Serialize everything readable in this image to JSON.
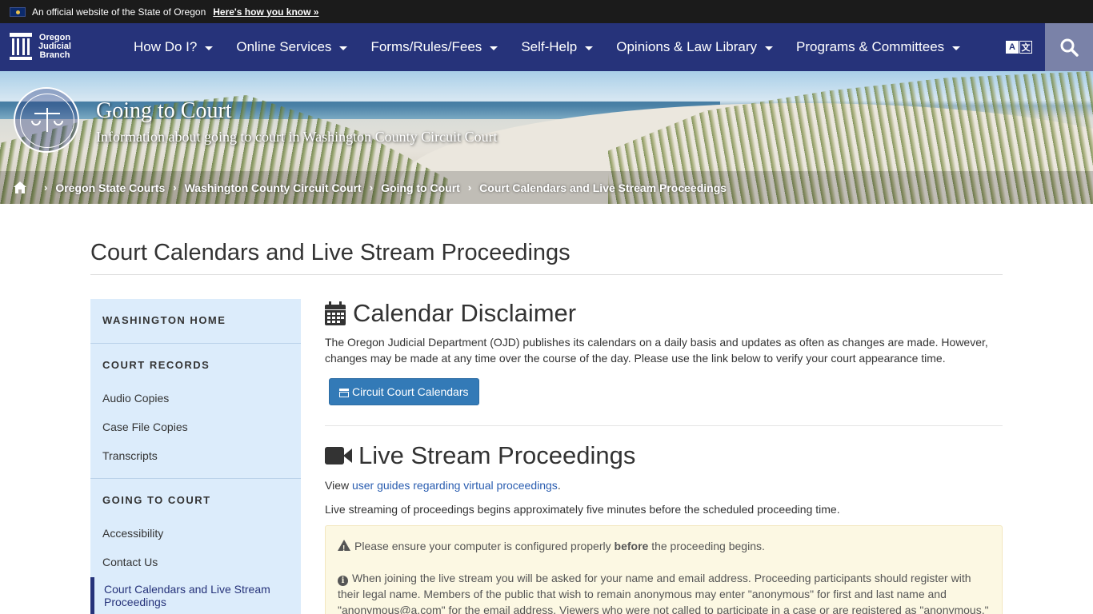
{
  "official_banner": {
    "text": "An official website of the State of Oregon",
    "link": "Here's how you know »"
  },
  "logo": {
    "line1": "Oregon",
    "line2": "Judicial",
    "line3": "Branch"
  },
  "nav": {
    "items": [
      {
        "label": "How Do I?"
      },
      {
        "label": "Online Services"
      },
      {
        "label": "Forms/Rules/Fees"
      },
      {
        "label": "Self-Help"
      },
      {
        "label": "Opinions & Law Library"
      },
      {
        "label": "Programs & Committees"
      }
    ],
    "translate_a": "A",
    "translate_b": "文"
  },
  "hero": {
    "title": "Going to Court",
    "subtitle": "Information about going to court in Washington County Circuit Court"
  },
  "breadcrumb": {
    "items": [
      "Oregon State Courts",
      "Washington County Circuit Court",
      "Going to Court",
      "Court Calendars and Live Stream Proceedings"
    ]
  },
  "page": {
    "title": "Court Calendars and Live Stream Proceedings"
  },
  "sidebar": {
    "home": "WASHINGTON HOME",
    "court_records": "COURT RECORDS",
    "records_links": [
      "Audio Copies",
      "Case File Copies",
      "Transcripts"
    ],
    "going_to_court": "GOING TO COURT",
    "gtc_links": [
      "Accessibility",
      "Contact Us"
    ],
    "active": "Court Calendars and Live Stream Proceedings"
  },
  "calendar": {
    "heading": "Calendar Disclaimer",
    "body": "The Oregon Judicial Department (OJD) publishes its calendars on a daily basis and updates as often as changes are made. However, changes may be made at any time over the course of the day. Please use the link below to verify your court appearance time.",
    "button": "Circuit Court Calendars"
  },
  "livestream": {
    "heading": "Live Stream Proceedings",
    "view_prefix": "View ",
    "view_link": "user guides regarding virtual proceedings",
    "view_suffix": ".",
    "begins": "Live streaming of proceedings begins approximately five minutes before the scheduled proceeding time.",
    "alert_warn_pre": "Please ensure your computer is configured properly ",
    "alert_warn_bold": "before",
    "alert_warn_post": " the proceeding begins.",
    "alert_info": "When joining the live stream you will be asked for your name and email address. Proceeding participants should register with their legal name. Members of the public that wish to remain anonymous may enter \"anonymous\" for first and last name and \"anonymous@a.com\" for the email address. Viewers who were not called to participate in a case or are registered as \"anonymous,\""
  },
  "colors": {
    "nav_bg": "#26337a",
    "sidebar_bg": "#dcecfb",
    "button_bg": "#337ab7",
    "alert_bg": "#fcf8e3",
    "link": "#2a5db0"
  },
  "icons": {
    "home": "home-icon",
    "search": "search-icon",
    "calendar": "calendar-icon",
    "video": "video-camera-icon",
    "warning": "warning-icon",
    "info": "info-icon"
  }
}
